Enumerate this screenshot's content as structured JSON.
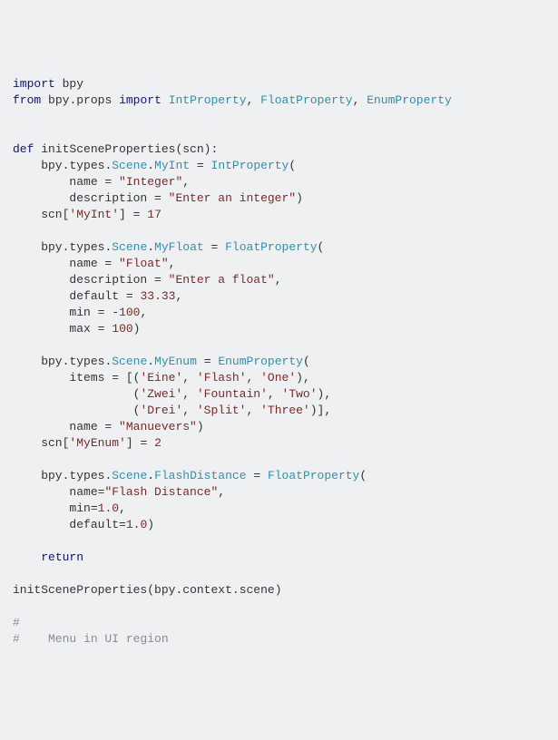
{
  "code": {
    "t1": "import",
    "t2": " bpy",
    "t3": "from",
    "t4": " bpy",
    "t5": ".",
    "t6": "props ",
    "t7": "import",
    "t8": " ",
    "t9": "IntProperty",
    "t10": ",",
    "t11": " ",
    "t12": "FloatProperty",
    "t13": ",",
    "t14": " ",
    "t15": "EnumProperty",
    "t20": "def",
    "t21": " initSceneProperties",
    "t22": "(",
    "t23": "scn",
    "t24": "):",
    "t30": "    bpy",
    "t31": ".",
    "t32": "types",
    "t33": ".",
    "t34": "Scene",
    "t35": ".",
    "t36": "MyInt",
    "t37": " ",
    "t38": "=",
    "t39": " ",
    "t40": "IntProperty",
    "t41": "(",
    "t50": "        name ",
    "t51": "=",
    "t52": " ",
    "t53": "\"Integer\"",
    "t54": ",",
    "t60": "        description ",
    "t61": "=",
    "t62": " ",
    "t63": "\"Enter an integer\"",
    "t64": ")",
    "t70": "    scn",
    "t71": "[",
    "t72": "'MyInt'",
    "t73": "]",
    "t74": " ",
    "t75": "=",
    "t76": " ",
    "t77": "17",
    "t80": "    bpy",
    "t81": ".",
    "t82": "types",
    "t83": ".",
    "t84": "Scene",
    "t85": ".",
    "t86": "MyFloat",
    "t87": " ",
    "t88": "=",
    "t89": " ",
    "t90": "FloatProperty",
    "t91": "(",
    "t100": "        name ",
    "t101": "=",
    "t102": " ",
    "t103": "\"Float\"",
    "t104": ",",
    "t110": "        description ",
    "t111": "=",
    "t112": " ",
    "t113": "\"Enter a float\"",
    "t114": ",",
    "t120": "        ",
    "t121": "default",
    "t122": " ",
    "t123": "=",
    "t124": " ",
    "t125": "33.33",
    "t126": ",",
    "t130": "        ",
    "t131": "min",
    "t132": " ",
    "t133": "=",
    "t134": " ",
    "t135": "-",
    "t136": "100",
    "t137": ",",
    "t140": "        ",
    "t141": "max",
    "t142": " ",
    "t143": "=",
    "t144": " ",
    "t145": "100",
    "t146": ")",
    "t150": "    bpy",
    "t151": ".",
    "t152": "types",
    "t153": ".",
    "t154": "Scene",
    "t155": ".",
    "t156": "MyEnum",
    "t157": " ",
    "t158": "=",
    "t159": " ",
    "t160": "EnumProperty",
    "t161": "(",
    "t170": "        items ",
    "t171": "=",
    "t172": " ",
    "t173": "[(",
    "t174": "'Eine'",
    "t175": ",",
    "t176": " ",
    "t177": "'Flash'",
    "t178": ",",
    "t179": " ",
    "t180": "'One'",
    "t181": "),",
    "t190": "                 ",
    "t191": "(",
    "t192": "'Zwei'",
    "t193": ",",
    "t194": " ",
    "t195": "'Fountain'",
    "t196": ",",
    "t197": " ",
    "t198": "'Two'",
    "t199": "),",
    "t200": "                 ",
    "t201": "(",
    "t202": "'Drei'",
    "t203": ",",
    "t204": " ",
    "t205": "'Split'",
    "t206": ",",
    "t207": " ",
    "t208": "'Three'",
    "t209": ")],",
    "t220": "        name ",
    "t221": "=",
    "t222": " ",
    "t223": "\"Manuevers\"",
    "t224": ")",
    "t230": "    scn",
    "t231": "[",
    "t232": "'MyEnum'",
    "t233": "]",
    "t234": " ",
    "t235": "=",
    "t236": " ",
    "t237": "2",
    "t240": "    bpy",
    "t241": ".",
    "t242": "types",
    "t243": ".",
    "t244": "Scene",
    "t245": ".",
    "t246": "FlashDistance",
    "t247": " ",
    "t248": "=",
    "t249": " ",
    "t250": "FloatProperty",
    "t251": "(",
    "t260": "        name",
    "t261": "=",
    "t262": "\"Flash Distance\"",
    "t263": ",",
    "t270": "        ",
    "t271": "min",
    "t272": "=",
    "t273": "1.0",
    "t274": ",",
    "t280": "        ",
    "t281": "default",
    "t282": "=",
    "t283": "1.0",
    "t284": ")",
    "t290": "    ",
    "t291": "return",
    "t300": "initSceneProperties",
    "t301": "(",
    "t302": "bpy",
    "t303": ".",
    "t304": "context",
    "t305": ".",
    "t306": "scene",
    "t307": ")",
    "t310": "#",
    "t311": "#    Menu in UI region"
  }
}
